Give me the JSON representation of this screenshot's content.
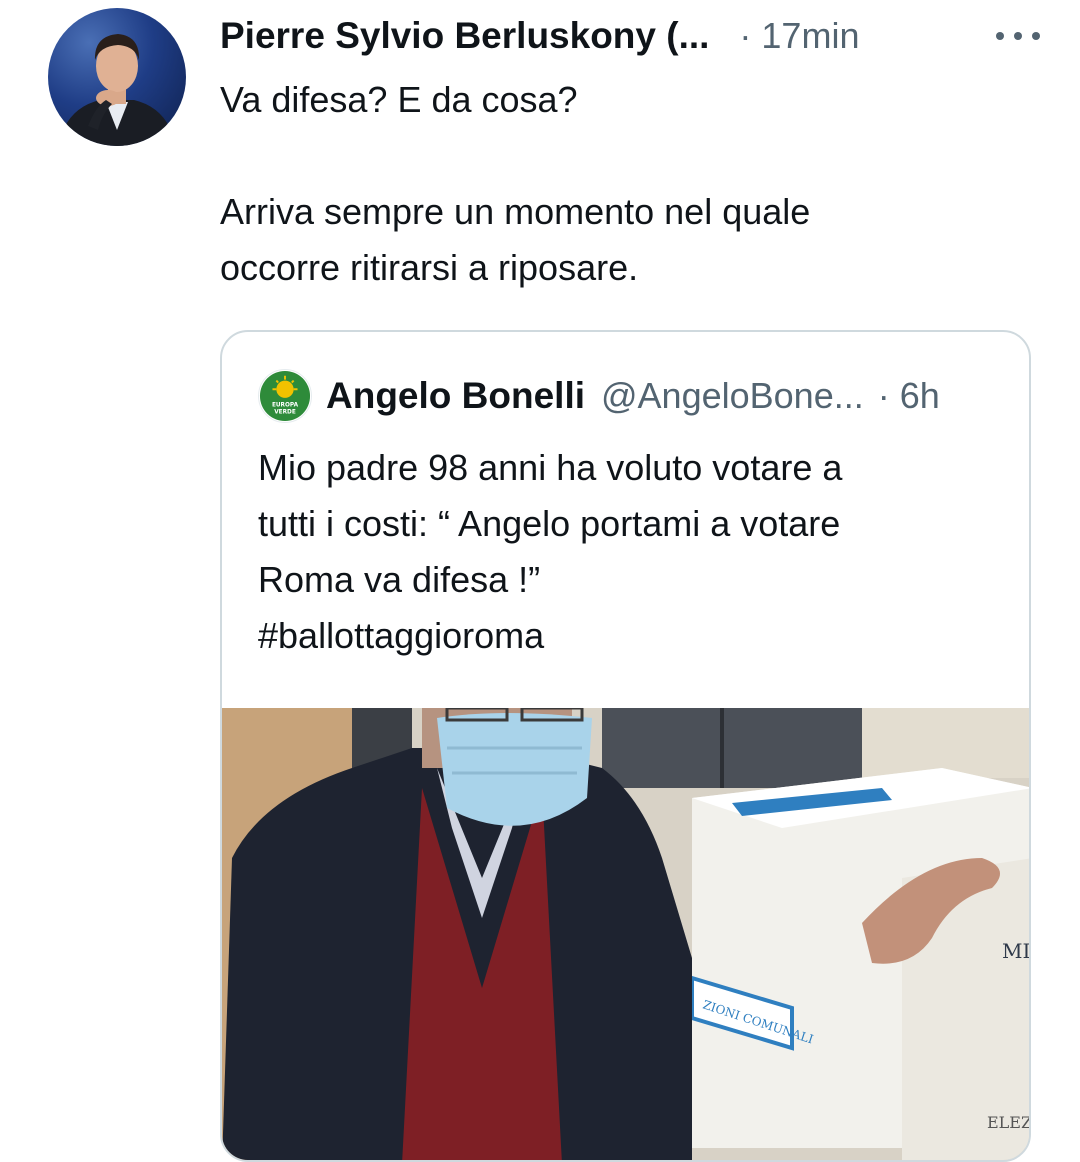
{
  "tweet": {
    "author": "Pierre Sylvio Berluskony (...",
    "time": "· 17min",
    "more_icon": "ellipsis-icon",
    "text_lines": [
      "Va difesa? E da cosa?",
      "Arriva sempre un momento nel quale",
      "occorre ritirarsi a riposare."
    ]
  },
  "quoted": {
    "name": "Angelo Bonelli",
    "handle": "@AngeloBone...",
    "time": "· 6h",
    "avatar_text_line1": "EUROPA",
    "avatar_text_line2": "VERDE",
    "text_lines": [
      "Mio padre 98 anni ha voluto votare a",
      "tutti i costi: “ Angelo portami a votare",
      "Roma va difesa !”",
      "#ballottaggioroma"
    ],
    "photo": {
      "box_label_1": "ZIONI COMUNALI",
      "box_label_2": "MINI",
      "box_label_3": "ELEZ"
    }
  },
  "colors": {
    "text": "#0f1419",
    "secondary": "#536471",
    "border": "#cfd9de",
    "party_green": "#2e8b3a",
    "party_yellow": "#f2c200"
  }
}
